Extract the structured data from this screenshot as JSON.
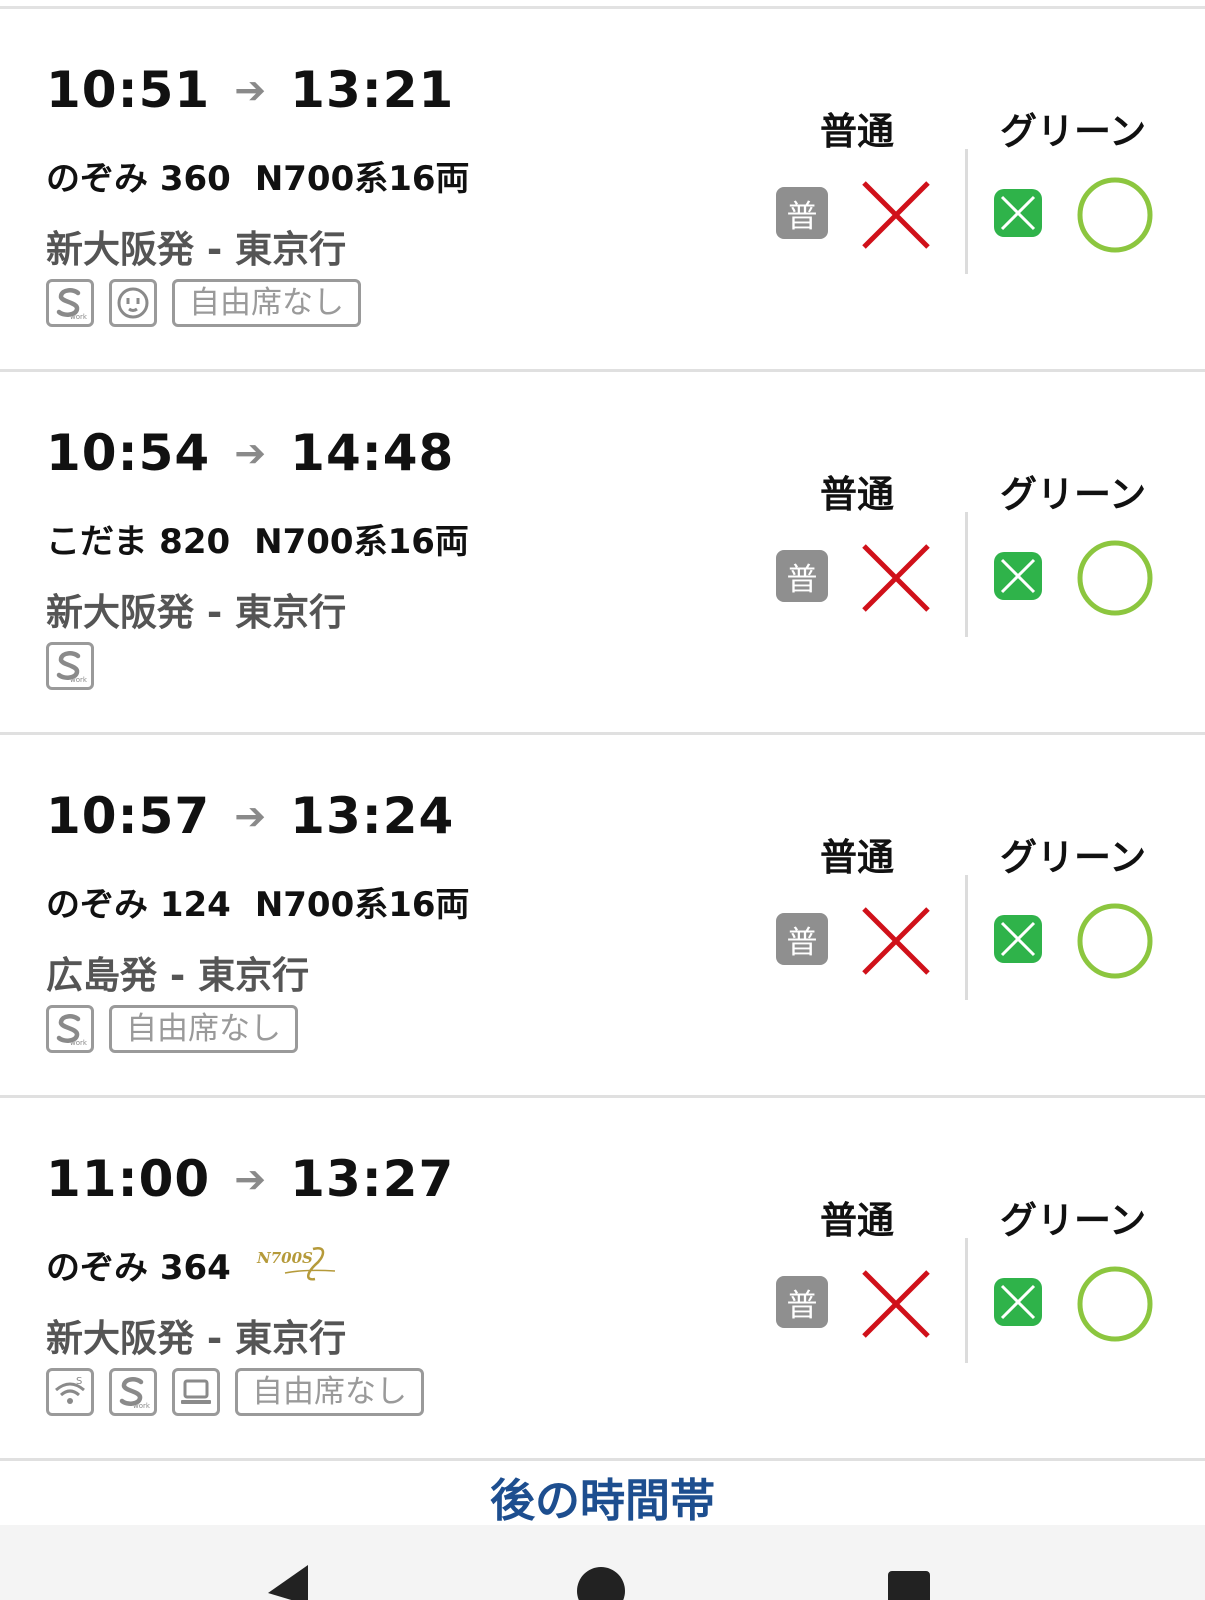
{
  "trains": [
    {
      "depart": "10:51",
      "arrive": "13:21",
      "name": "のぞみ 360",
      "car_type": "N700系16両",
      "route": "新大阪発 - 東京行",
      "features": [
        "s-work",
        "outlet"
      ],
      "no_free_seat_label": "自由席なし",
      "ordinary_status": "×",
      "green_status": "○"
    },
    {
      "depart": "10:54",
      "arrive": "14:48",
      "name": "こだま 820",
      "car_type": "N700系16両",
      "route": "新大阪発 - 東京行",
      "features": [
        "s-work"
      ],
      "no_free_seat_label": "",
      "ordinary_status": "×",
      "green_status": "○"
    },
    {
      "depart": "10:57",
      "arrive": "13:24",
      "name": "のぞみ 124",
      "car_type": "N700系16両",
      "route": "広島発 - 東京行",
      "features": [
        "s-work"
      ],
      "no_free_seat_label": "自由席なし",
      "ordinary_status": "×",
      "green_status": "○"
    },
    {
      "depart": "11:00",
      "arrive": "13:27",
      "name": "のぞみ 364",
      "car_type": "",
      "car_logo": "N700S",
      "route": "新大阪発 - 東京行",
      "features": [
        "wifi",
        "s-work",
        "laptop"
      ],
      "no_free_seat_label": "自由席なし",
      "ordinary_status": "×",
      "green_status": "○"
    }
  ],
  "labels": {
    "ordinary_header": "普通",
    "green_header": "グリーン",
    "ordinary_badge": "普",
    "later_time": "後の時間帯"
  },
  "colors": {
    "unavailable": "#d0111a",
    "available": "#8cc63f",
    "green_car": "#2fb34a",
    "link": "#1d4e8f"
  },
  "icons": [
    "s-work-icon",
    "outlet-icon",
    "wifi-icon",
    "laptop-icon",
    "green-car-icon",
    "arrow-icon",
    "nav-back-icon",
    "nav-home-icon",
    "nav-recent-icon"
  ]
}
